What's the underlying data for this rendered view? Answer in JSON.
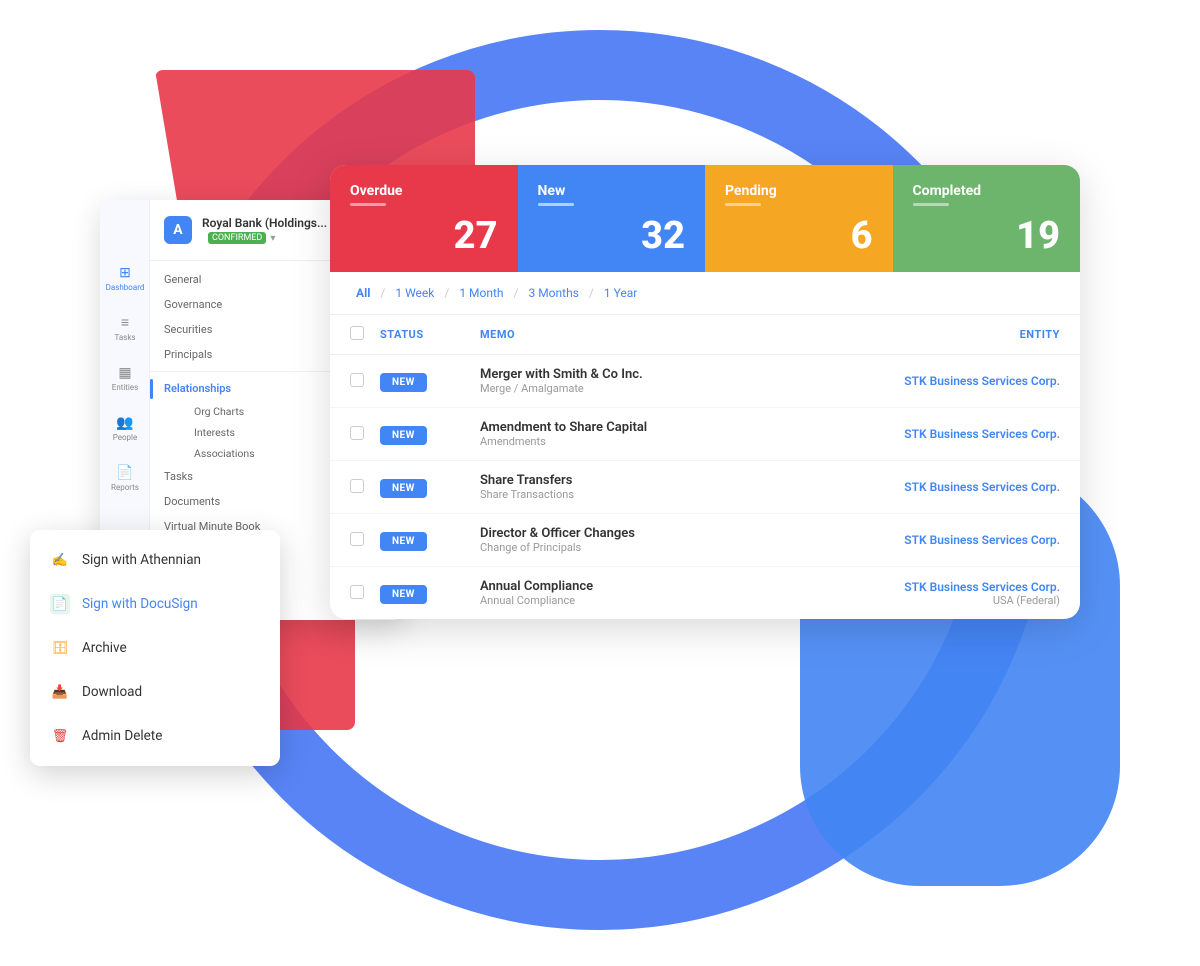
{
  "background": {
    "circle_color": "#3b6ef5",
    "red_shape_color": "#e8394a",
    "blue_shape_color": "#4285f4"
  },
  "sidebar": {
    "logo_text": "A",
    "org_name": "Royal Bank (Holdings...",
    "badge_text": "CONFIRMED",
    "nav_items": [
      {
        "icon": "⊞",
        "label": "Dashboard"
      },
      {
        "icon": "≡",
        "label": "Tasks"
      },
      {
        "icon": "▦",
        "label": "Entities"
      },
      {
        "icon": "👥",
        "label": "People"
      },
      {
        "icon": "📄",
        "label": "Reports"
      }
    ],
    "menu_items": [
      {
        "label": "General"
      },
      {
        "label": "Governance"
      },
      {
        "label": "Securities"
      },
      {
        "label": "Principals"
      }
    ],
    "active_group": "Relationships",
    "sub_items": [
      {
        "label": "Org Charts",
        "active": false
      },
      {
        "label": "Interests",
        "active": false
      },
      {
        "label": "Associations",
        "active": false
      }
    ],
    "bottom_items": [
      {
        "label": "Tasks"
      },
      {
        "label": "Documents"
      },
      {
        "label": "Virtual Minute Book"
      }
    ]
  },
  "context_menu": {
    "items": [
      {
        "id": "sign-athennian",
        "label": "Sign with Athennian",
        "icon": "✍",
        "color": "athennian"
      },
      {
        "id": "sign-docusign",
        "label": "Sign with DocuSign",
        "icon": "📄",
        "color": "docusign",
        "active": true
      },
      {
        "id": "archive",
        "label": "Archive",
        "icon": "🗄",
        "color": "archive"
      },
      {
        "id": "download",
        "label": "Download",
        "icon": "📥",
        "color": "download"
      },
      {
        "id": "admin-delete",
        "label": "Admin Delete",
        "icon": "🗑",
        "color": "delete"
      }
    ]
  },
  "stats": [
    {
      "id": "overdue",
      "label": "Overdue",
      "count": "27",
      "class": "overdue"
    },
    {
      "id": "new",
      "label": "New",
      "count": "32",
      "class": "new"
    },
    {
      "id": "pending",
      "label": "Pending",
      "count": "6",
      "class": "pending"
    },
    {
      "id": "completed",
      "label": "Completed",
      "count": "19",
      "class": "completed"
    }
  ],
  "filters": {
    "links": [
      {
        "label": "All",
        "active": true
      },
      {
        "label": "1 Week",
        "active": false
      },
      {
        "label": "1 Month",
        "active": false
      },
      {
        "label": "3 Months",
        "active": false
      },
      {
        "label": "1 Year",
        "active": false
      }
    ]
  },
  "table": {
    "headers": {
      "status": "STATUS",
      "memo": "MEMO",
      "entity": "ENTITY"
    },
    "rows": [
      {
        "status": "NEW",
        "memo_title": "Merger with Smith & Co Inc.",
        "memo_sub": "Merge / Amalgamate",
        "entity_name": "STK Business Services Corp.",
        "entity_sub": ""
      },
      {
        "status": "NEW",
        "memo_title": "Amendment to Share Capital",
        "memo_sub": "Amendments",
        "entity_name": "STK Business Services Corp.",
        "entity_sub": ""
      },
      {
        "status": "NEW",
        "memo_title": "Share Transfers",
        "memo_sub": "Share Transactions",
        "entity_name": "STK Business Services Corp.",
        "entity_sub": ""
      },
      {
        "status": "NEW",
        "memo_title": "Director & Officer Changes",
        "memo_sub": "Change of Principals",
        "entity_name": "STK Business Services Corp.",
        "entity_sub": ""
      },
      {
        "status": "NEW",
        "memo_title": "Annual Compliance",
        "memo_sub": "Annual Compliance",
        "entity_name": "STK Business Services Corp.",
        "entity_sub": "USA (Federal)"
      }
    ]
  }
}
